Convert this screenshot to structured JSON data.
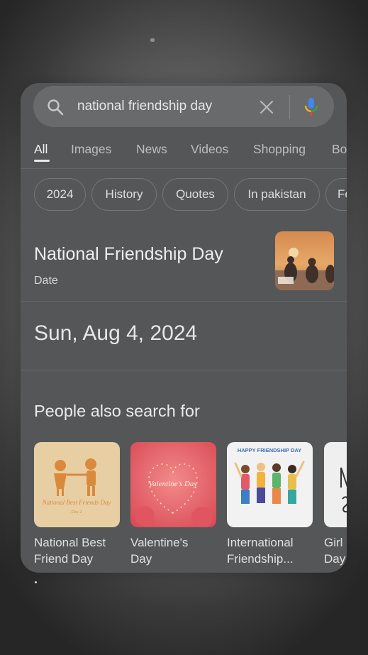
{
  "search": {
    "query": "national friendship day"
  },
  "tabs": [
    {
      "label": "All",
      "active": true
    },
    {
      "label": "Images"
    },
    {
      "label": "News"
    },
    {
      "label": "Videos"
    },
    {
      "label": "Shopping"
    },
    {
      "label": "Bo"
    }
  ],
  "chips": [
    "2024",
    "History",
    "Quotes",
    "In pakistan",
    "Fe"
  ],
  "entity": {
    "title": "National Friendship Day",
    "subtitle": "Date",
    "answer": "Sun, Aug 4, 2024"
  },
  "people_also_search": {
    "title": "People also search for",
    "items": [
      {
        "label": "National Best\nFriend Day",
        "image_text": "National Best Friends Day",
        "image_subtext": "Day 2"
      },
      {
        "label": "Valentine's\nDay",
        "image_text": "Valentine's Day"
      },
      {
        "label": "International\nFriendship...",
        "image_text": "HAPPY FRIENDSHIP DAY"
      },
      {
        "label": "Girl\nDay"
      }
    ]
  },
  "colors": {
    "mic_blue": "#4285f4",
    "mic_red": "#ea4335",
    "mic_yellow": "#fbbc04",
    "mic_green": "#34a853"
  }
}
